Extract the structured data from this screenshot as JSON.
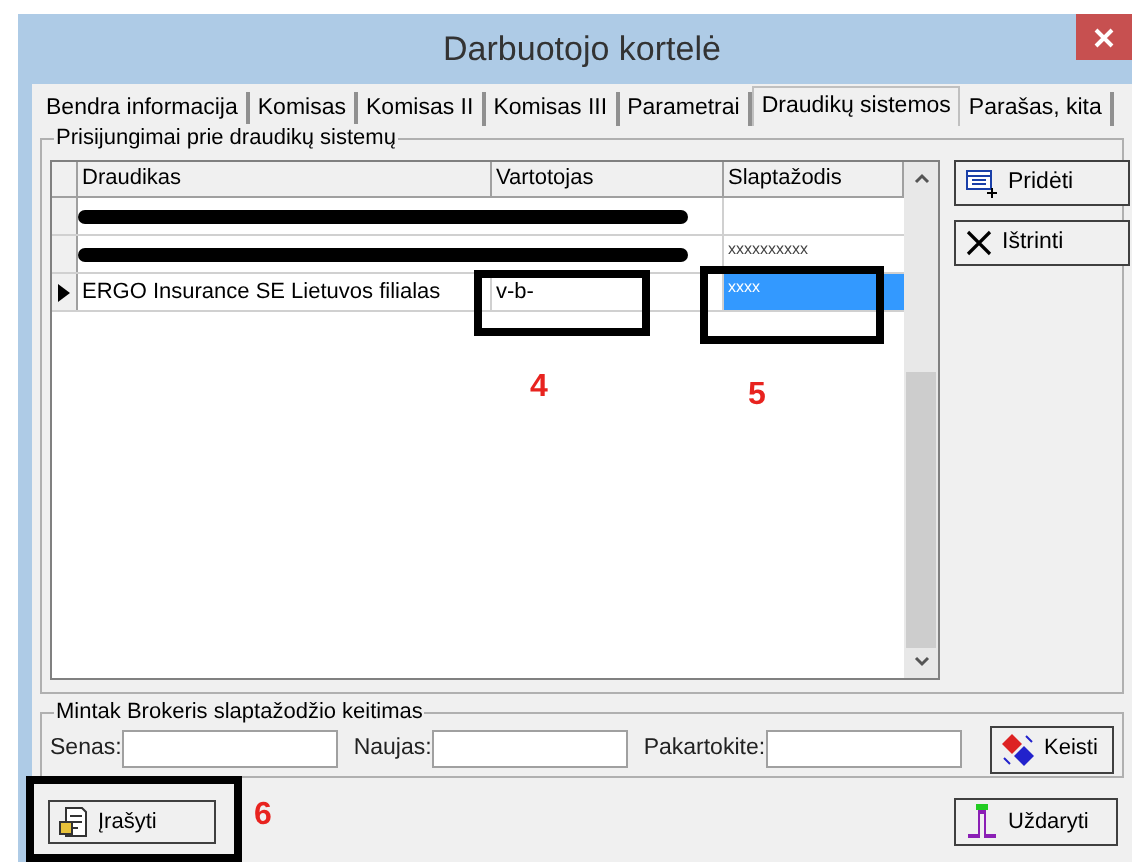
{
  "window": {
    "title": "Darbuotojo kortelė"
  },
  "tabs": [
    {
      "label": "Bendra informacija",
      "selected": false
    },
    {
      "label": "Komisas",
      "selected": false
    },
    {
      "label": "Komisas II",
      "selected": false
    },
    {
      "label": "Komisas III",
      "selected": false
    },
    {
      "label": "Parametrai",
      "selected": false
    },
    {
      "label": "Draudikų sistemos",
      "selected": true
    },
    {
      "label": "Parašas, kita",
      "selected": false
    }
  ],
  "group": {
    "title": "Prisijungimai prie draudikų sistemų"
  },
  "table": {
    "columns": [
      "Draudikas",
      "Vartotojas",
      "Slaptažodis"
    ],
    "rows": [
      {
        "kind": "redacted",
        "selected": false
      },
      {
        "kind": "redacted",
        "password": "xxxxxxxxxx",
        "selected": false
      },
      {
        "kind": "normal",
        "insurer": "ERGO Insurance SE Lietuvos filialas",
        "user": "v-b-",
        "password": "xxxx",
        "selected": true
      }
    ]
  },
  "side_buttons": [
    {
      "kind": "add",
      "label": "Pridėti"
    },
    {
      "kind": "delete",
      "label": "Ištrinti"
    }
  ],
  "password_change": {
    "title": "Mintak Brokeris slaptažodžio keitimas",
    "fields": [
      {
        "label": "Senas:"
      },
      {
        "label": "Naujas:"
      },
      {
        "label": "Pakartokite:"
      }
    ],
    "button": "Keisti"
  },
  "footer": {
    "save": "Įrašyti",
    "close": "Uždaryti"
  },
  "annotations": [
    "4",
    "5",
    "6"
  ]
}
